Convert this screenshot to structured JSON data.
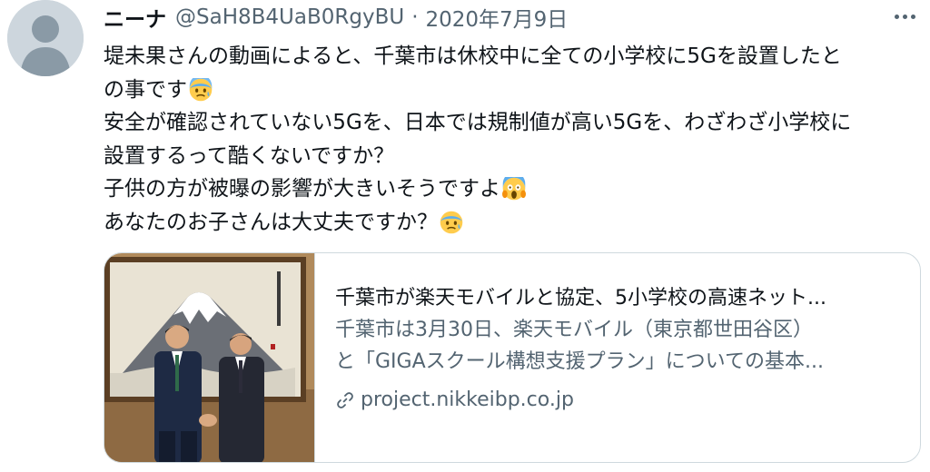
{
  "tweet": {
    "display_name": "ニーナ",
    "handle": "@SaH8B4UaB0RgyBU",
    "separator": "·",
    "date": "2020年7月9日",
    "avatar_icon": "default-avatar-icon",
    "more_icon": "more-options-icon",
    "text_lines": [
      "堤未果さんの動画によると、千葉市は休校中に全ての小学校に5Gを設置したと",
      "の事です",
      "安全が確認されていない5Gを、日本では規制値が高い5Gを、わざわざ小学校に",
      "設置するって酷くないですか？",
      "子供の方が被曝の影響が大きいそうですよ",
      "あなたのお子さんは大丈夫ですか？"
    ],
    "emojis": [
      "anxious-face-with-sweat-emoji",
      "screaming-face-emoji",
      "anxious-face-with-sweat-emoji"
    ]
  },
  "card": {
    "title": "千葉市が楽天モバイルと協定、5小学校の高速ネット...",
    "description_lines": [
      "千葉市は3月30日、楽天モバイル（東京都世田谷区）",
      "と「GIGAスクール構想支援プラン」についての基本..."
    ],
    "domain": "project.nikkeibp.co.jp",
    "link_icon": "link-icon",
    "image_subject": "two men shaking hands in front of a Mount Fuji painting"
  },
  "colors": {
    "text": "#0f1419",
    "secondary": "#536471",
    "border": "#cfd9de",
    "avatar_bg": "#cdd6dd",
    "avatar_fg": "#8a9aa6"
  }
}
